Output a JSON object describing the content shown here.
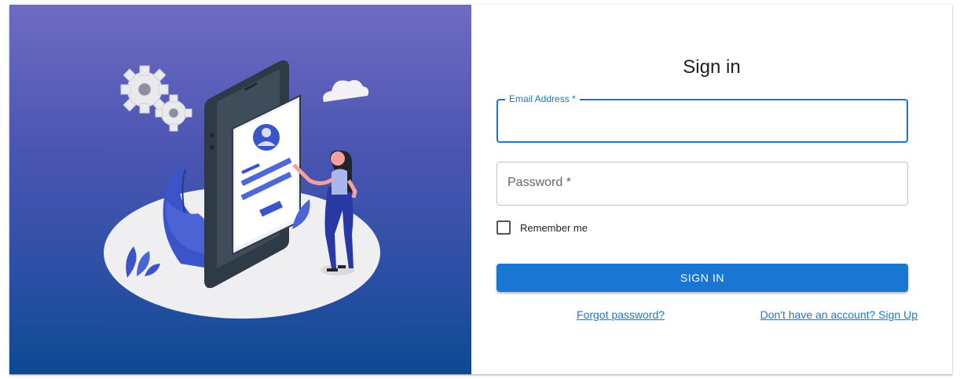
{
  "form": {
    "title": "Sign in",
    "email": {
      "label": "Email Address *",
      "value": ""
    },
    "password": {
      "label": "Password *",
      "value": ""
    },
    "remember_label": "Remember me",
    "remember_checked": false,
    "submit_label": "Sign In",
    "forgot_link": "Forgot password?",
    "signup_link": "Don't have an account? Sign Up"
  },
  "colors": {
    "primary": "#1976d2",
    "hero_top": "#6f6bc2",
    "hero_bottom": "#0c4a92"
  },
  "illustration": {
    "icons": [
      "gear-icon",
      "cloud-icon",
      "smartphone-icon",
      "avatar-icon",
      "person-icon",
      "leaf-icon"
    ]
  }
}
